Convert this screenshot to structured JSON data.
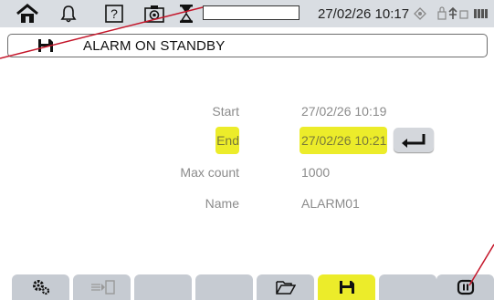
{
  "status_bar": {
    "icons": [
      "home-icon",
      "bell-icon",
      "help-icon",
      "camera-icon",
      "hourglass-icon"
    ],
    "help_glyph": "?",
    "datetime": "27/02/26 10:17",
    "progress": 0.0,
    "right_icons": [
      "sun-icon",
      "lock-usb-icon",
      "battery-icon"
    ]
  },
  "header": {
    "icon": "save-icon",
    "title": "ALARM ON STANDBY"
  },
  "form": {
    "start_label": "Start",
    "start_value": "27/02/26 10:19",
    "end_label": "End",
    "end_value": "27/02/26 10:21",
    "max_count_label": "Max count",
    "max_count_value": "1000",
    "name_label": "Name",
    "name_value": "ALARM01"
  },
  "tabs": [
    {
      "icon": "settings-icon",
      "active": false
    },
    {
      "icon": "export-icon",
      "active": false
    },
    {
      "icon": "",
      "active": false
    },
    {
      "icon": "",
      "active": false
    },
    {
      "icon": "folder-icon",
      "active": false
    },
    {
      "icon": "save-icon",
      "active": true
    },
    {
      "icon": "",
      "active": false
    },
    {
      "icon": "pause-icon",
      "active": false
    }
  ],
  "colors": {
    "highlight": "#ecec2a",
    "status_bar": "#d9dde2",
    "tab": "#c6cbd2",
    "annotation": "#c4162a"
  }
}
